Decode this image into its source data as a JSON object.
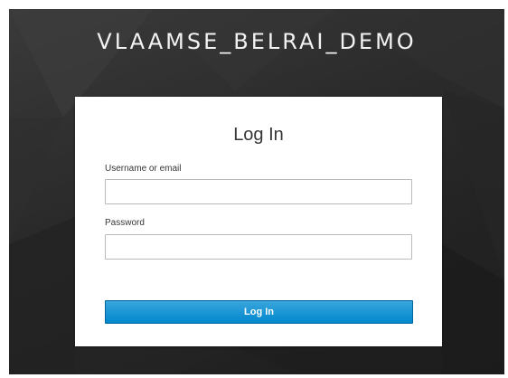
{
  "realm": {
    "title": "VLAAMSE_BELRAI_DEMO"
  },
  "login_form": {
    "heading": "Log In",
    "username_label": "Username or email",
    "username_value": "",
    "password_label": "Password",
    "password_value": "",
    "submit_label": "Log In"
  },
  "colors": {
    "background": "#2b2b2b",
    "card": "#ffffff",
    "button": "#0088ce",
    "button_border": "#00659c",
    "text": "#363636"
  }
}
